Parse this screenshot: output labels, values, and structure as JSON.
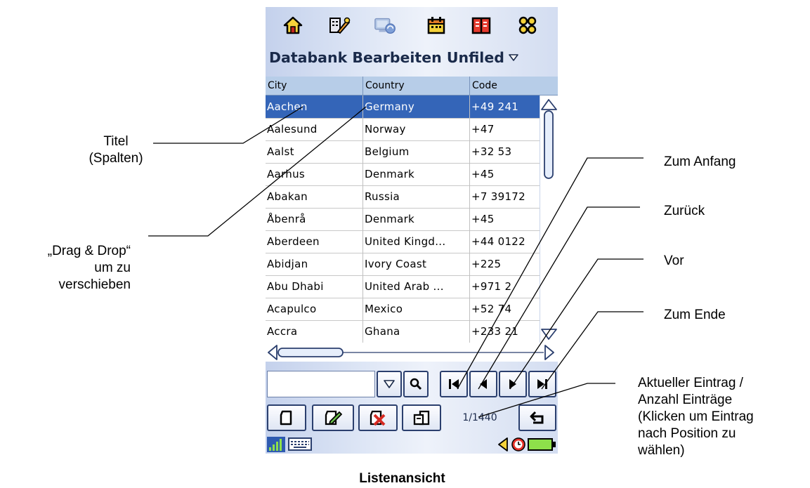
{
  "title_bar": {
    "title": "Databank Bearbeiten Unfiled"
  },
  "top_icons": [
    "home-icon",
    "tools-icon",
    "sync-icon",
    "calendar-icon",
    "book-icon",
    "apps-icon"
  ],
  "table": {
    "columns": [
      "City",
      "Country",
      "Code"
    ],
    "rows": [
      [
        "Aachen",
        "Germany",
        "+49 241"
      ],
      [
        "Aalesund",
        "Norway",
        "+47"
      ],
      [
        "Aalst",
        "Belgium",
        "+32 53"
      ],
      [
        "Aarhus",
        "Denmark",
        "+45"
      ],
      [
        "Abakan",
        "Russia",
        "+7 39172"
      ],
      [
        "Åbenrå",
        "Denmark",
        "+45"
      ],
      [
        "Aberdeen",
        "United Kingd...",
        "+44 0122"
      ],
      [
        "Abidjan",
        "Ivory Coast",
        "+225"
      ],
      [
        "Abu Dhabi",
        "United Arab ...",
        "+971 2"
      ],
      [
        "Acapulco",
        "Mexico",
        "+52 74"
      ],
      [
        "Accra",
        "Ghana",
        "+233 21"
      ]
    ],
    "selected_row": 0
  },
  "search": {
    "value": ""
  },
  "record_counter": "1/1440",
  "colors": {
    "selection": "#3465b8",
    "header": "#b7cde8",
    "accent": "#2b3f6e"
  },
  "annotations": {
    "titel": "Titel\n(Spalten)",
    "drag_drop": "„Drag & Drop“\num zu\nverschieben",
    "zum_anfang": "Zum Anfang",
    "zurueck": "Zurück",
    "vor": "Vor",
    "zum_ende": "Zum Ende",
    "aktueller_eintrag": "Aktueller Eintrag /\nAnzahl Einträge\n(Klicken um Eintrag\nnach Position zu\nwählen)"
  },
  "caption": "Listenansicht"
}
